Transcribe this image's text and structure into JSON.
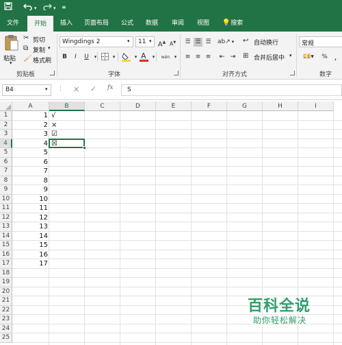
{
  "quick_access": {
    "save_icon": "save-icon",
    "undo_icon": "undo-icon",
    "redo_icon": "redo-icon",
    "customize": "customize-qat-icon"
  },
  "tabs": [
    {
      "label": "文件"
    },
    {
      "label": "开始"
    },
    {
      "label": "插入"
    },
    {
      "label": "页面布局"
    },
    {
      "label": "公式"
    },
    {
      "label": "数据"
    },
    {
      "label": "审阅"
    },
    {
      "label": "视图"
    }
  ],
  "search": {
    "label": "搜索",
    "icon": "lightbulb-icon"
  },
  "ribbon": {
    "clipboard": {
      "paste": "粘贴",
      "cut": "剪切",
      "copy": "复制",
      "format_painter": "格式刷",
      "group_label": "剪贴板"
    },
    "font": {
      "font_name": "Wingdings 2",
      "font_size": "11",
      "bold": "B",
      "italic": "I",
      "underline": "U",
      "wen": "wén",
      "group_label": "字体",
      "font_color": "#d0302a",
      "fill_color": "#f7d33f"
    },
    "alignment": {
      "wrap_text": "自动换行",
      "merge_center": "合并后居中",
      "group_label": "对齐方式"
    },
    "number": {
      "format": "常规",
      "group_label": "数字"
    }
  },
  "formula_bar": {
    "name_box": "B4",
    "fx": "fx",
    "content": "S"
  },
  "sheet": {
    "columns": [
      "A",
      "B",
      "C",
      "D",
      "E",
      "F",
      "G",
      "H",
      "I"
    ],
    "selected_cell": "B4",
    "rows": [
      {
        "num": "1",
        "a": "1",
        "b": "√"
      },
      {
        "num": "2",
        "a": "2",
        "b": "×"
      },
      {
        "num": "3",
        "a": "3",
        "b": "☑"
      },
      {
        "num": "4",
        "a": "4",
        "b": "☒"
      },
      {
        "num": "5",
        "a": "5",
        "b": ""
      },
      {
        "num": "6",
        "a": "6",
        "b": ""
      },
      {
        "num": "7",
        "a": "7",
        "b": ""
      },
      {
        "num": "8",
        "a": "8",
        "b": ""
      },
      {
        "num": "9",
        "a": "9",
        "b": ""
      },
      {
        "num": "10",
        "a": "10",
        "b": ""
      },
      {
        "num": "11",
        "a": "11",
        "b": ""
      },
      {
        "num": "12",
        "a": "12",
        "b": ""
      },
      {
        "num": "13",
        "a": "13",
        "b": ""
      },
      {
        "num": "14",
        "a": "14",
        "b": ""
      },
      {
        "num": "15",
        "a": "15",
        "b": ""
      },
      {
        "num": "16",
        "a": "16",
        "b": ""
      },
      {
        "num": "17",
        "a": "17",
        "b": ""
      },
      {
        "num": "18",
        "a": "",
        "b": ""
      },
      {
        "num": "19",
        "a": "",
        "b": ""
      },
      {
        "num": "20",
        "a": "",
        "b": ""
      },
      {
        "num": "21",
        "a": "",
        "b": ""
      },
      {
        "num": "22",
        "a": "",
        "b": ""
      },
      {
        "num": "23",
        "a": "",
        "b": ""
      },
      {
        "num": "24",
        "a": "",
        "b": ""
      },
      {
        "num": "25",
        "a": "",
        "b": ""
      }
    ]
  },
  "watermark": {
    "title": "百科全说",
    "subtitle": "助你轻松解决",
    "color": "#2e9e6b"
  }
}
